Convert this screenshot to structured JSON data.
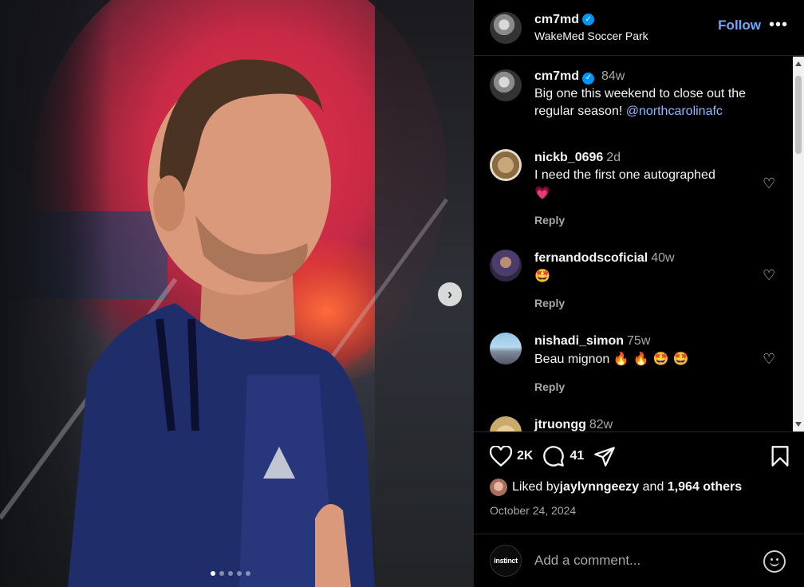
{
  "post": {
    "author": "cm7md",
    "verified_mark": "✓",
    "location": "WakeMed Soccer Park",
    "follow_label": "Follow",
    "more_label": "•••",
    "caption": {
      "author": "cm7md",
      "age": "84w",
      "text": "Big one this weekend to close out the regular season! ",
      "mention": "@northcarolinafc"
    }
  },
  "media": {
    "next_label": "›",
    "slides": 5,
    "active_slide": 1
  },
  "comments": [
    {
      "user": "nickb_0696",
      "age": "2d",
      "text": "I need the first one autographed",
      "emoji": "💗",
      "reply": "Reply"
    },
    {
      "user": "fernandodscoficial",
      "age": "40w",
      "text": "",
      "emoji": "🤩",
      "reply": "Reply"
    },
    {
      "user": "nishadi_simon",
      "age": "75w",
      "text": "Beau mignon ",
      "emoji": "🔥 🔥 🤩 🤩",
      "reply": "Reply"
    },
    {
      "user": "jtruongg",
      "age": "82w"
    }
  ],
  "actions": {
    "likes_short": "2K",
    "comments_count": "41"
  },
  "liked_by": {
    "prefix": "Liked by ",
    "user": "jaylynngeezy",
    "middle": " and ",
    "others": "1,964 others"
  },
  "date": "October 24, 2024",
  "add_comment": {
    "avatar_text": "instinct",
    "placeholder": "Add a comment..."
  },
  "icons": {
    "like": "heart-icon",
    "comment": "comment-bubble-icon",
    "share": "paper-plane-icon",
    "save": "bookmark-icon",
    "emoji": "smiley-icon"
  }
}
